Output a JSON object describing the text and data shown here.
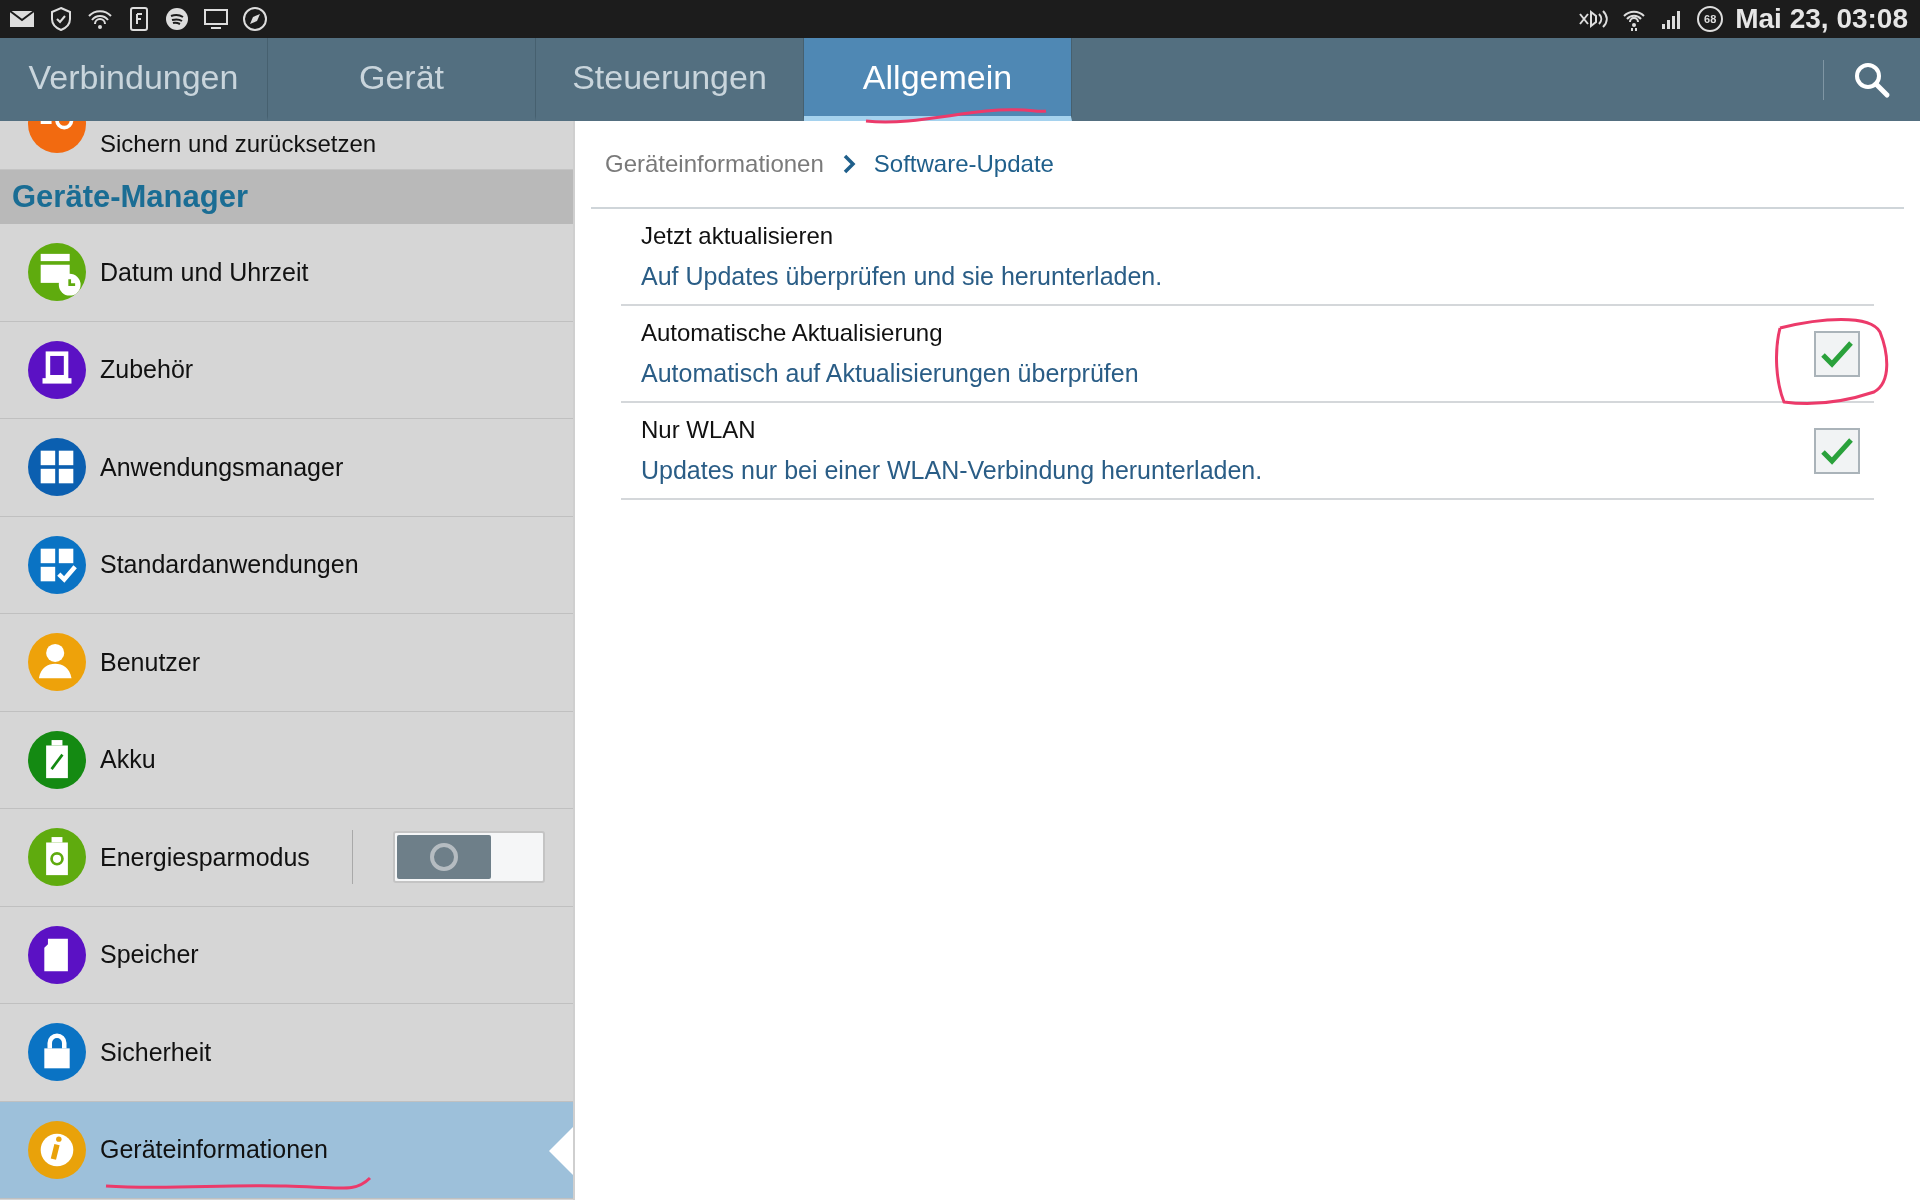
{
  "status_bar": {
    "battery": "68",
    "clock": "Mai 23, 03:08"
  },
  "tabs": [
    {
      "label": "Verbindungen",
      "selected": false
    },
    {
      "label": "Gerät",
      "selected": false
    },
    {
      "label": "Steuerungen",
      "selected": false
    },
    {
      "label": "Allgemein",
      "selected": true
    }
  ],
  "sidebar": {
    "partial_item": {
      "label": "Sichern und zurücksetzen",
      "color": "#f26a10"
    },
    "section": "Geräte-Manager",
    "items": [
      {
        "label": "Datum und Uhrzeit",
        "color": "#5fab0e",
        "selected": false
      },
      {
        "label": "Zubehör",
        "color": "#5b11c4",
        "selected": false
      },
      {
        "label": "Anwendungsmanager",
        "color": "#0b5fb0",
        "selected": false
      },
      {
        "label": "Standardanwendungen",
        "color": "#0a73c4",
        "selected": false
      },
      {
        "label": "Benutzer",
        "color": "#eea20a",
        "selected": false
      },
      {
        "label": "Akku",
        "color": "#148a12",
        "selected": false
      },
      {
        "label": "Energiesparmodus",
        "color": "#5fab0e",
        "selected": false,
        "kind": "toggle",
        "on": false
      },
      {
        "label": "Speicher",
        "color": "#5b11c4",
        "selected": false
      },
      {
        "label": "Sicherheit",
        "color": "#0a73c4",
        "selected": false
      },
      {
        "label": "Geräteinformationen",
        "color": "#e9a20a",
        "selected": true
      }
    ]
  },
  "breadcrumb": [
    "Geräteinformationen",
    "Software-Update"
  ],
  "settings": [
    {
      "title": "Jetzt aktualisieren",
      "subtitle": "Auf Updates überprüfen und sie herunterladen.",
      "kind": "action"
    },
    {
      "title": "Automatische Aktualisierung",
      "subtitle": "Automatisch auf Aktualisierungen überprüfen",
      "kind": "checkbox",
      "checked": true
    },
    {
      "title": "Nur WLAN",
      "subtitle": "Updates nur bei einer WLAN-Verbindung herunterladen.",
      "kind": "checkbox",
      "checked": true
    }
  ]
}
